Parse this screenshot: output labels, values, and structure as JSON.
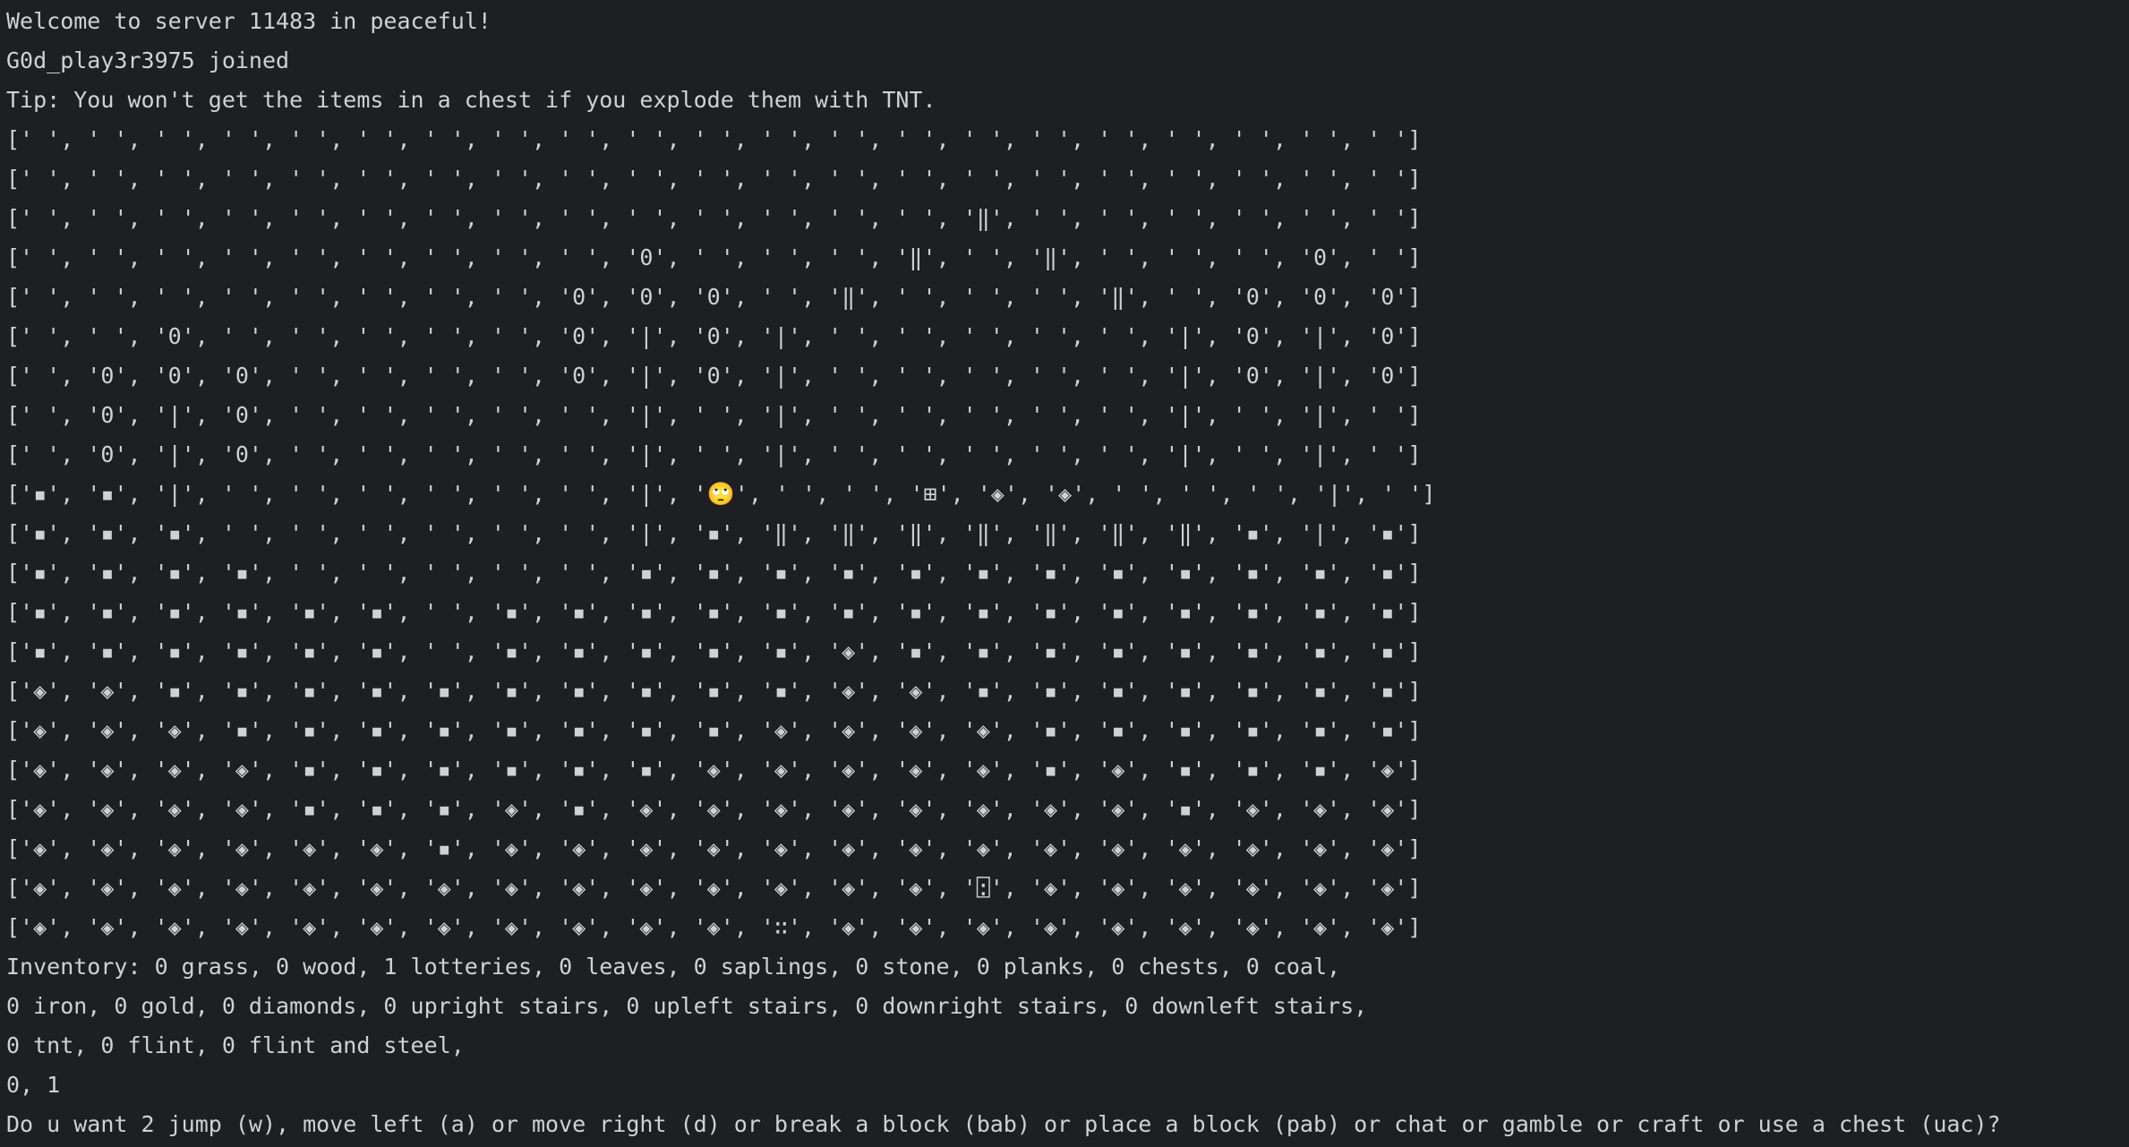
{
  "messages": {
    "welcome": "Welcome to server 11483 in peaceful!",
    "joined": "G0d_play3r3975 joined",
    "tip": "Tip: You won't get the items in a chest if you explode them with TNT."
  },
  "grid_rows": [
    "[' ', ' ', ' ', ' ', ' ', ' ', ' ', ' ', ' ', ' ', ' ', ' ', ' ', ' ', ' ', ' ', ' ', ' ', ' ', ' ', ' ']",
    "[' ', ' ', ' ', ' ', ' ', ' ', ' ', ' ', ' ', ' ', ' ', ' ', ' ', ' ', ' ', ' ', ' ', ' ', ' ', ' ', ' ']",
    "[' ', ' ', ' ', ' ', ' ', ' ', ' ', ' ', ' ', ' ', ' ', ' ', ' ', ' ', '‖', ' ', ' ', ' ', ' ', ' ', ' ']",
    "[' ', ' ', ' ', ' ', ' ', ' ', ' ', ' ', ' ', '0', ' ', ' ', ' ', '‖', ' ', '‖', ' ', ' ', ' ', '0', ' ']",
    "[' ', ' ', ' ', ' ', ' ', ' ', ' ', ' ', '0', '0', '0', ' ', '‖', ' ', ' ', ' ', '‖', ' ', '0', '0', '0']",
    "[' ', ' ', '0', ' ', ' ', ' ', ' ', ' ', '0', '|', '0', '|', ' ', ' ', ' ', ' ', ' ', '|', '0', '|', '0']",
    "[' ', '0', '0', '0', ' ', ' ', ' ', ' ', '0', '|', '0', '|', ' ', ' ', ' ', ' ', ' ', '|', '0', '|', '0']",
    "[' ', '0', '|', '0', ' ', ' ', ' ', ' ', ' ', '|', ' ', '|', ' ', ' ', ' ', ' ', ' ', '|', ' ', '|', ' ']",
    "[' ', '0', '|', '0', ' ', ' ', ' ', ' ', ' ', '|', ' ', '|', ' ', ' ', ' ', ' ', ' ', '|', ' ', '|', ' ']",
    "['▪', '▪', '|', ' ', ' ', ' ', ' ', ' ', ' ', '|', '🙄', ' ', ' ', '⊞', '◈', '◈', ' ', ' ', ' ', '|', ' ']",
    "['▪', '▪', '▪', ' ', ' ', ' ', ' ', ' ', ' ', '|', '▪', '‖', '‖', '‖', '‖', '‖', '‖', '‖', '▪', '|', '▪']",
    "['▪', '▪', '▪', '▪', ' ', ' ', ' ', ' ', ' ', '▪', '▪', '▪', '▪', '▪', '▪', '▪', '▪', '▪', '▪', '▪', '▪']",
    "['▪', '▪', '▪', '▪', '▪', '▪', ' ', '▪', '▪', '▪', '▪', '▪', '▪', '▪', '▪', '▪', '▪', '▪', '▪', '▪', '▪']",
    "['▪', '▪', '▪', '▪', '▪', '▪', ' ', '▪', '▪', '▪', '▪', '▪', '◈', '▪', '▪', '▪', '▪', '▪', '▪', '▪', '▪']",
    "['◈', '◈', '▪', '▪', '▪', '▪', '▪', '▪', '▪', '▪', '▪', '▪', '◈', '◈', '▪', '▪', '▪', '▪', '▪', '▪', '▪']",
    "['◈', '◈', '◈', '▪', '▪', '▪', '▪', '▪', '▪', '▪', '▪', '◈', '◈', '◈', '◈', '▪', '▪', '▪', '▪', '▪', '▪']",
    "['◈', '◈', '◈', '◈', '▪', '▪', '▪', '▪', '▪', '▪', '◈', '◈', '◈', '◈', '◈', '▪', '◈', '▪', '▪', '▪', '◈']",
    "['◈', '◈', '◈', '◈', '▪', '▪', '▪', '◈', '▪', '◈', '◈', '◈', '◈', '◈', '◈', '◈', '◈', '▪', '◈', '◈', '◈']",
    "['◈', '◈', '◈', '◈', '◈', '◈', '▪', '◈', '◈', '◈', '◈', '◈', '◈', '◈', '◈', '◈', '◈', '◈', '◈', '◈', '◈']",
    "['◈', '◈', '◈', '◈', '◈', '◈', '◈', '◈', '◈', '◈', '◈', '◈', '◈', '◈', '⍠', '◈', '◈', '◈', '◈', '◈', '◈']",
    "['◈', '◈', '◈', '◈', '◈', '◈', '◈', '◈', '◈', '◈', '◈', '∷', '◈', '◈', '◈', '◈', '◈', '◈', '◈', '◈', '◈']"
  ],
  "inventory": {
    "line1": "Inventory: 0 grass, 0 wood, 1 lotteries, 0 leaves, 0 saplings, 0 stone, 0 planks, 0 chests, 0 coal,",
    "line2": "0 iron, 0 gold, 0 diamonds, 0 upright stairs, 0 upleft stairs, 0 downright stairs, 0 downleft stairs,",
    "line3": "0 tnt, 0 flint, 0 flint and steel,"
  },
  "coordinates": "0, 1",
  "prompt": "Do u want 2 jump (w), move left (a) or move right (d) or break a block (bab) or place a block (pab) or chat or gamble or craft or use a chest (uac)?",
  "colors": {
    "background": "#1e1f22",
    "text": "#d0d1d5"
  }
}
